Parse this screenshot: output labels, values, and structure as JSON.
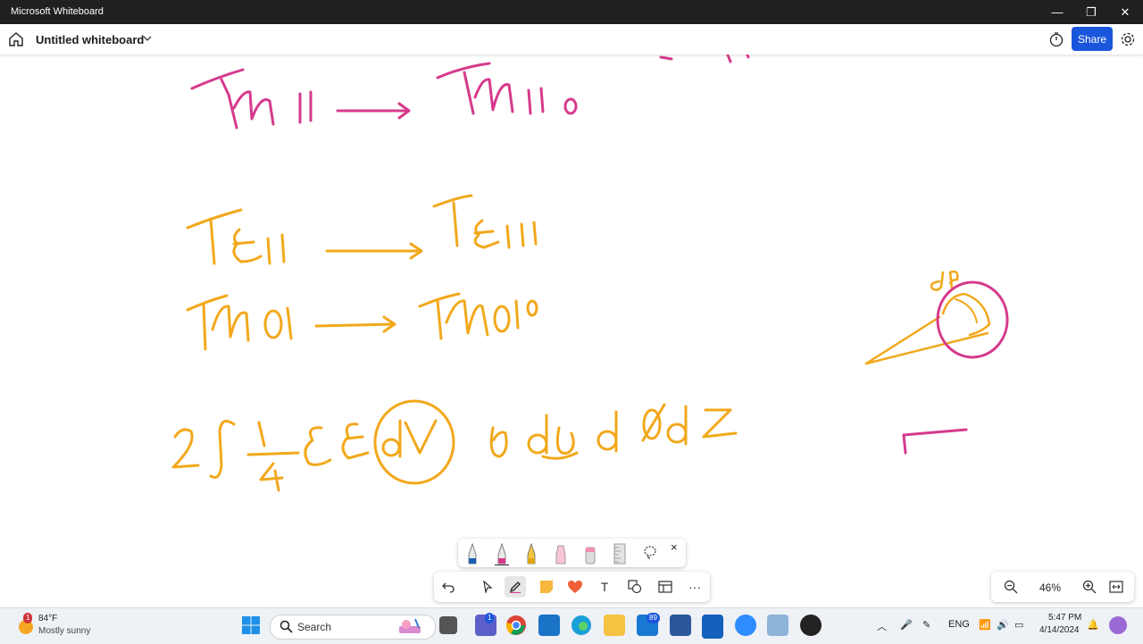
{
  "window": {
    "title": "Microsoft Whiteboard",
    "controls": [
      "minimize-icon",
      "restore-icon",
      "close-icon"
    ]
  },
  "appbar": {
    "board_name": "Untitled whiteboard",
    "share_label": "Share"
  },
  "colors": {
    "pink_ink": "#d63a8c",
    "orange_ink": "#f2a81b",
    "share_blue": "#1a56db",
    "title_bar": "#202020"
  },
  "ink": {
    "line1": [
      "TM 11",
      "TM110"
    ],
    "line2": [
      "TE11",
      "TE111"
    ],
    "line3": [
      "TM01",
      "TM010"
    ],
    "integral": [
      "2",
      "∫",
      "1",
      "4",
      "ε",
      "E",
      "dV",
      "ρdρdφdz"
    ],
    "sketch_label": "dρ"
  },
  "pen_tray": {
    "pens": [
      "blue-pen",
      "pink-pen",
      "yellow-pencil",
      "pink-highlighter",
      "eraser",
      "ruler",
      "lasso"
    ],
    "close": "×"
  },
  "toolbar": {
    "tools": [
      "undo",
      "select",
      "pen",
      "sticky-note",
      "reaction",
      "text",
      "shapes",
      "templates",
      "more"
    ],
    "text_glyph": "T",
    "more_glyph": "···"
  },
  "zoom": {
    "level": "46%"
  },
  "taskbar": {
    "weather": {
      "temp": "84°F",
      "desc": "Mostly sunny",
      "badge": "1"
    },
    "search_label": "Search",
    "teams_badge": "1",
    "mail_badge": "89",
    "language": "ENG",
    "time": "5:47 PM",
    "date": "4/14/2024"
  }
}
